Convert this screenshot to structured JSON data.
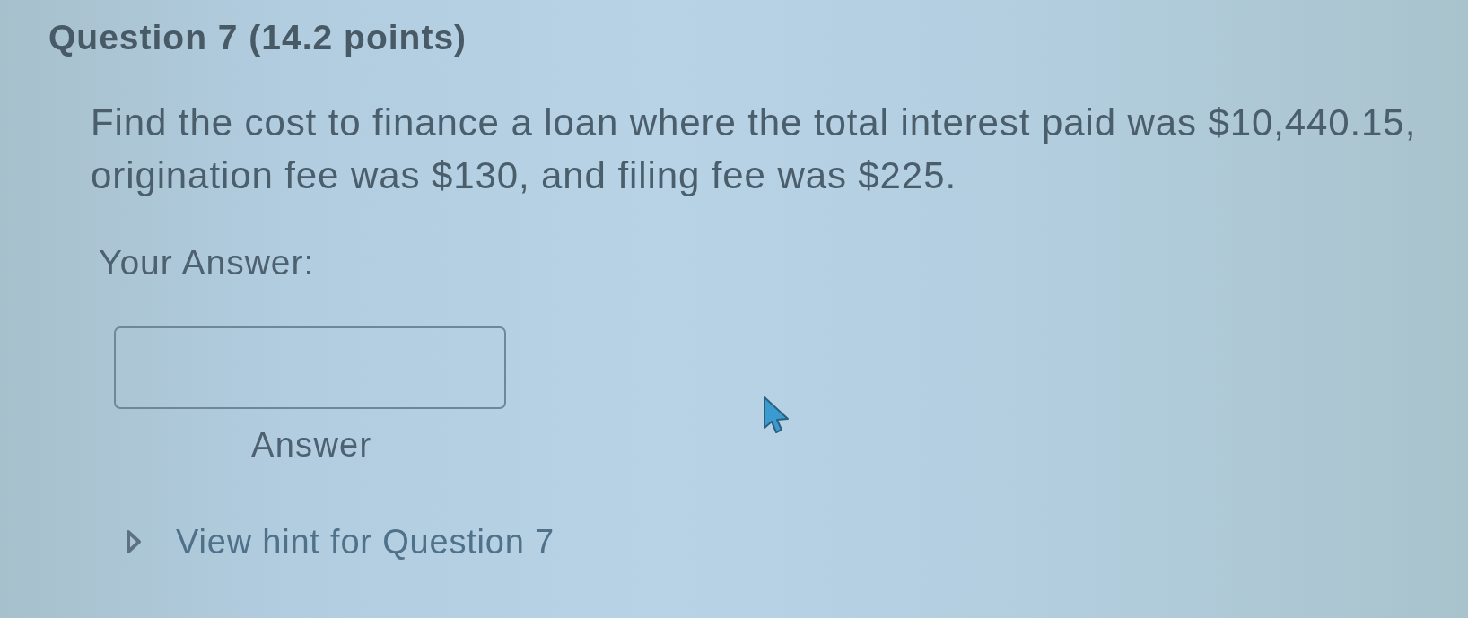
{
  "question": {
    "title": "Question 7 (14.2 points)",
    "text": "Find the cost to finance a loan where the total interest paid was $10,440.15, origination fee was $130, and filing fee was $225."
  },
  "answer": {
    "label": "Your Answer:",
    "caption": "Answer"
  },
  "hint": {
    "label": "View hint for Question 7",
    "expanded": false
  }
}
